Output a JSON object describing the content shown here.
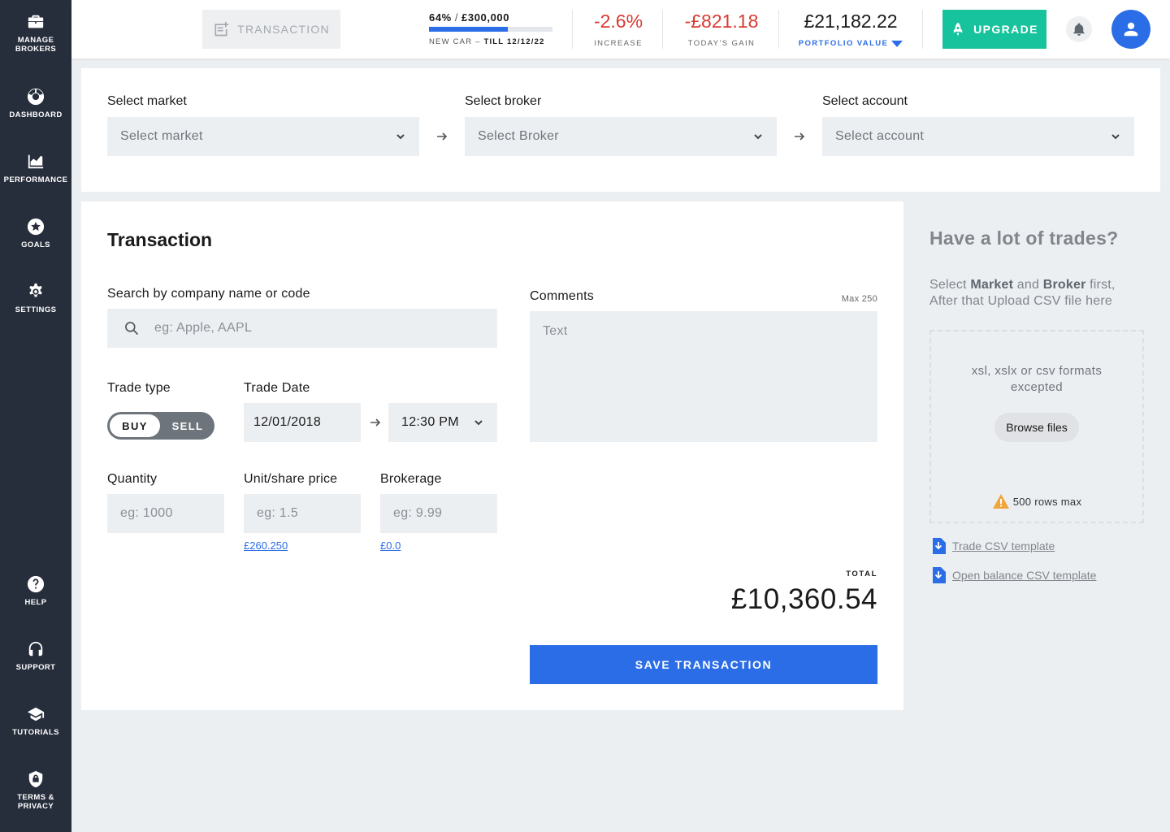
{
  "sidebar": {
    "items": [
      {
        "label": "Manage brokers",
        "icon": "briefcase-icon"
      },
      {
        "label": "Dashboard",
        "icon": "dashboard-icon"
      },
      {
        "label": "Performance",
        "icon": "chart-icon"
      },
      {
        "label": "Goals",
        "icon": "star-icon"
      },
      {
        "label": "Settings",
        "icon": "gear-icon"
      },
      {
        "label": "Help",
        "icon": "help-icon"
      },
      {
        "label": "Support",
        "icon": "headset-icon"
      },
      {
        "label": "Tutorials",
        "icon": "graduation-cap-icon"
      },
      {
        "label": "Terms & privacy",
        "icon": "lock-shield-icon"
      }
    ]
  },
  "header": {
    "transaction_button": "TRANSACTION",
    "goal": {
      "percent_label": "64%",
      "progress": 0.64,
      "target": "£300,000",
      "name": "NEW CAR",
      "till_label": "TILL 12/12/22"
    },
    "increase": {
      "value": "-2.6%",
      "label": "INCREASE"
    },
    "gain": {
      "value": "-£821.18",
      "label": "TODAY'S GAIN"
    },
    "portfolio": {
      "value": "£21,182.22",
      "label": "PORTFOLIO VALUE"
    },
    "upgrade_button": "UPGRADE",
    "colors": {
      "accent": "#2B6DE6",
      "upgrade": "#17C39C",
      "negative": "#D83B33",
      "sidebar": "#262D3B"
    }
  },
  "selectors": {
    "market": {
      "label": "Select market",
      "placeholder": "Select market"
    },
    "broker": {
      "label": "Select broker",
      "placeholder": "Select Broker"
    },
    "account": {
      "label": "Select account",
      "placeholder": "Select account"
    }
  },
  "transaction": {
    "title": "Transaction",
    "search": {
      "label": "Search by company name or code",
      "placeholder": "eg: Apple, AAPL"
    },
    "trade_type": {
      "label": "Trade type",
      "options": [
        "BUY",
        "SELL"
      ],
      "selected": "BUY"
    },
    "trade_date": {
      "label": "Trade Date",
      "date": "12/01/2018",
      "time": "12:30 PM"
    },
    "quantity": {
      "label": "Quantity",
      "placeholder": "eg: 1000"
    },
    "unit_price": {
      "label": "Unit/share price",
      "placeholder": "eg: 1.5",
      "link": "£260.250"
    },
    "brokerage": {
      "label": "Brokerage",
      "placeholder": "eg: 9.99",
      "link": "£0.0"
    },
    "comments": {
      "label": "Comments",
      "max": "Max 250",
      "placeholder": "Text"
    },
    "total": {
      "label": "TOTAL",
      "value": "£10,360.54"
    },
    "save_button": "SAVE TRANSACTION"
  },
  "csv": {
    "title": "Have a lot of trades?",
    "desc_1": "Select",
    "desc_market": "Market",
    "desc_and": "and",
    "desc_broker": "Broker",
    "desc_2": "first, After that Upload CSV file here",
    "formats": "xsl, xslx or csv formats excepted",
    "browse_button": "Browse files",
    "rows_max": "500 rows max",
    "templates": [
      "Trade CSV template",
      "Open balance CSV template"
    ]
  }
}
